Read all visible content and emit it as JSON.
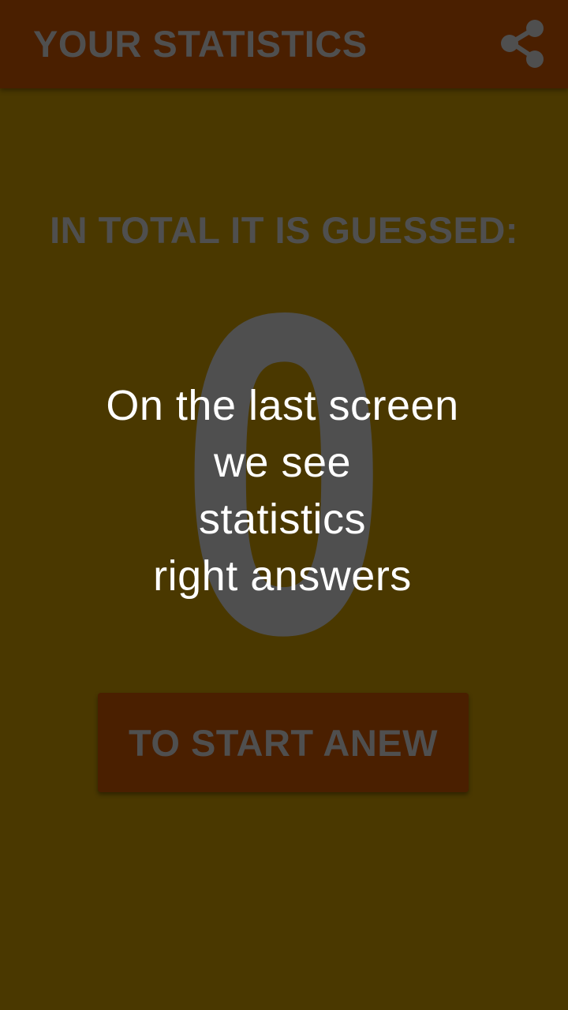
{
  "toolbar": {
    "title": "YOUR STATISTICS",
    "share_icon": "share-icon"
  },
  "stats": {
    "label": "IN TOTAL IT IS GUESSED:",
    "count": "0"
  },
  "overlay": {
    "lines": [
      "On the last screen",
      "we see",
      "statistics",
      "right answers"
    ]
  },
  "actions": {
    "restart_label": "TO START ANEW"
  },
  "colors": {
    "background": "#4a3800",
    "toolbar": "#4a1f00",
    "button": "#4a1f00",
    "dim_text": "#4f4f4f",
    "overlay_text": "#ffffff"
  }
}
